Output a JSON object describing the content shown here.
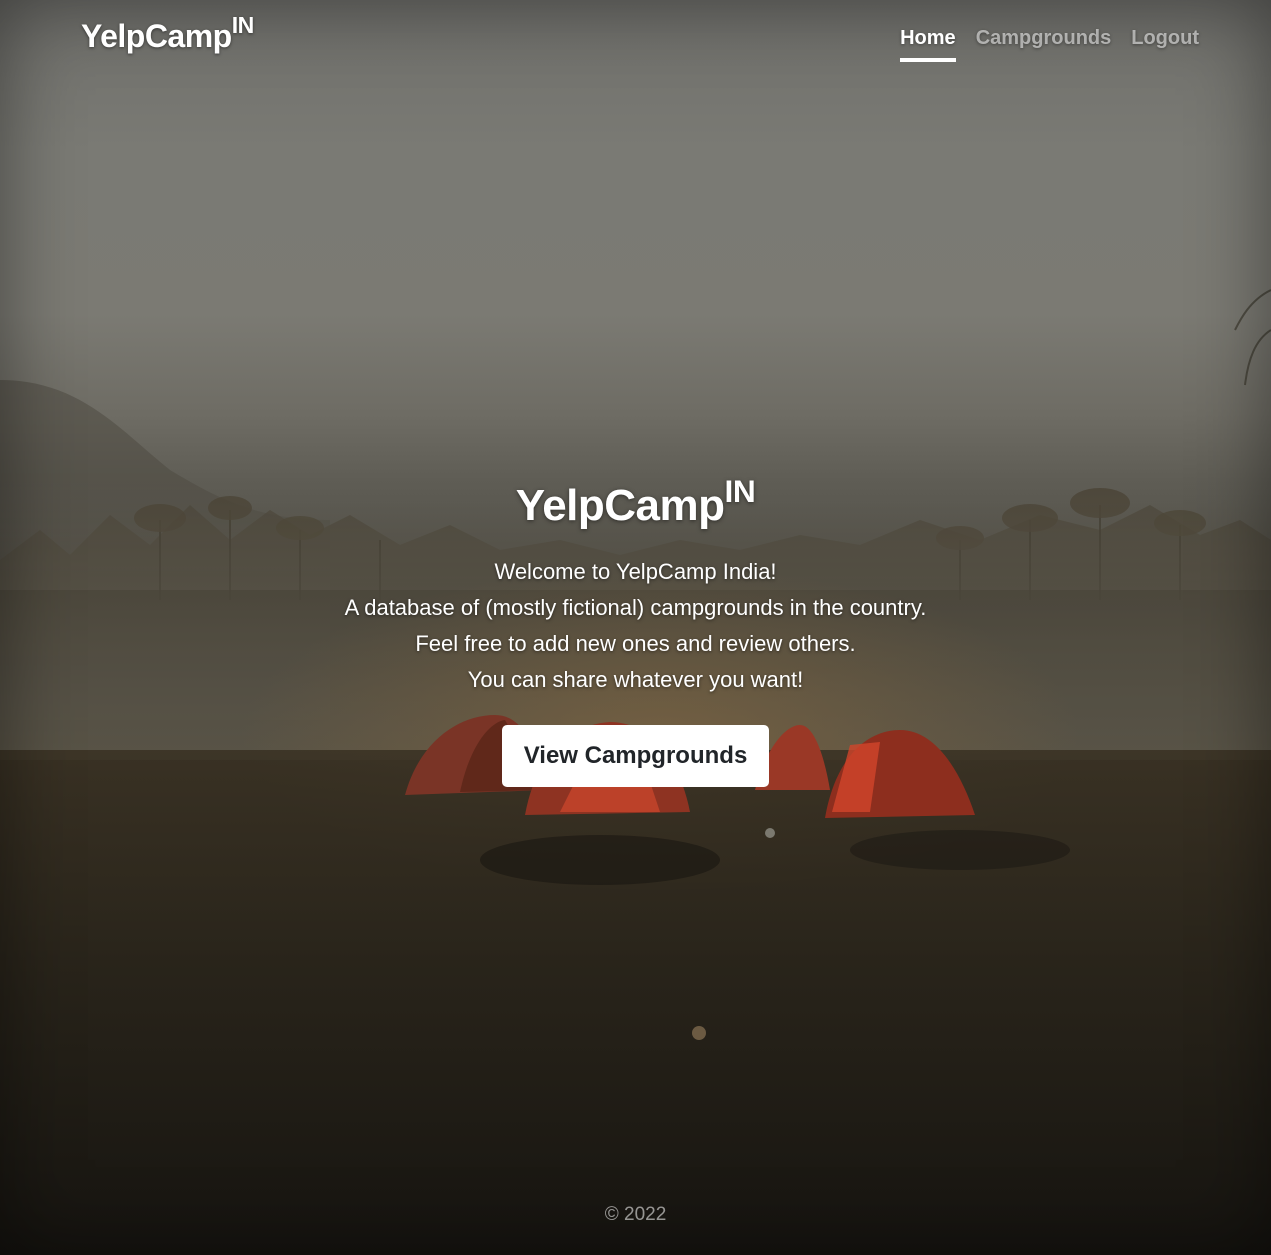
{
  "header": {
    "brand_main": "YelpCamp",
    "brand_sup": "IN",
    "nav": [
      {
        "label": "Home",
        "active": true
      },
      {
        "label": "Campgrounds",
        "active": false
      },
      {
        "label": "Logout",
        "active": false
      }
    ]
  },
  "hero": {
    "title_main": "YelpCamp",
    "title_sup": "IN",
    "lines": [
      "Welcome to YelpCamp India!",
      "A database of (mostly fictional) campgrounds in the country.",
      "Feel free to add new ones and review others.",
      "You can share whatever you want!"
    ],
    "button_label": "View Campgrounds"
  },
  "footer": {
    "copyright": "© 2022"
  },
  "theme": {
    "text": "#ffffff",
    "muted_text": "rgba(255,255,255,0.55)",
    "button_bg": "#ffffff",
    "button_text": "#212529"
  }
}
